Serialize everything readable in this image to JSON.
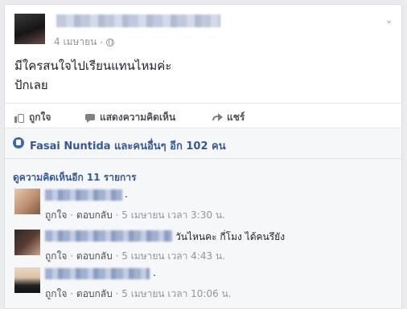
{
  "post": {
    "date": "4 เมษายน",
    "separator": "·",
    "text_line1": "มีใครสนใจไปเรียนแทนไหมค่ะ",
    "text_line2": "ปักเลย",
    "privacy_icon": "globe-icon",
    "options_icon": "chevron-down-icon"
  },
  "actions": {
    "like_label": "ถูกใจ",
    "comment_label": "แสดงความคิดเห็น",
    "share_label": "แชร์"
  },
  "likes": {
    "summary": "Fasai Nuntida และคนอื่นๆ อีก 102 คน"
  },
  "comments": {
    "more_label": "ดูความคิดเห็นอีก 11 รายการ",
    "items": [
      {
        "text": ".",
        "like": "ถูกใจ",
        "reply": "ตอบกลับ",
        "sep": "·",
        "time": "5 เมษายน เวลา 3:30 น."
      },
      {
        "text": "วันไหนคะ กี่โมง ได้คนรึยัง",
        "like": "ถูกใจ",
        "reply": "ตอบกลับ",
        "sep": "·",
        "time": "5 เมษายน เวลา 4:43 น."
      },
      {
        "text": ".",
        "like": "ถูกใจ",
        "reply": "ตอบกลับ",
        "sep": "·",
        "time": "5 เมษายน เวลา 10:06 น."
      }
    ]
  },
  "colors": {
    "link": "#365899",
    "meta": "#90949c",
    "background": "#e9ebee",
    "like_badge": "#4267b2"
  }
}
